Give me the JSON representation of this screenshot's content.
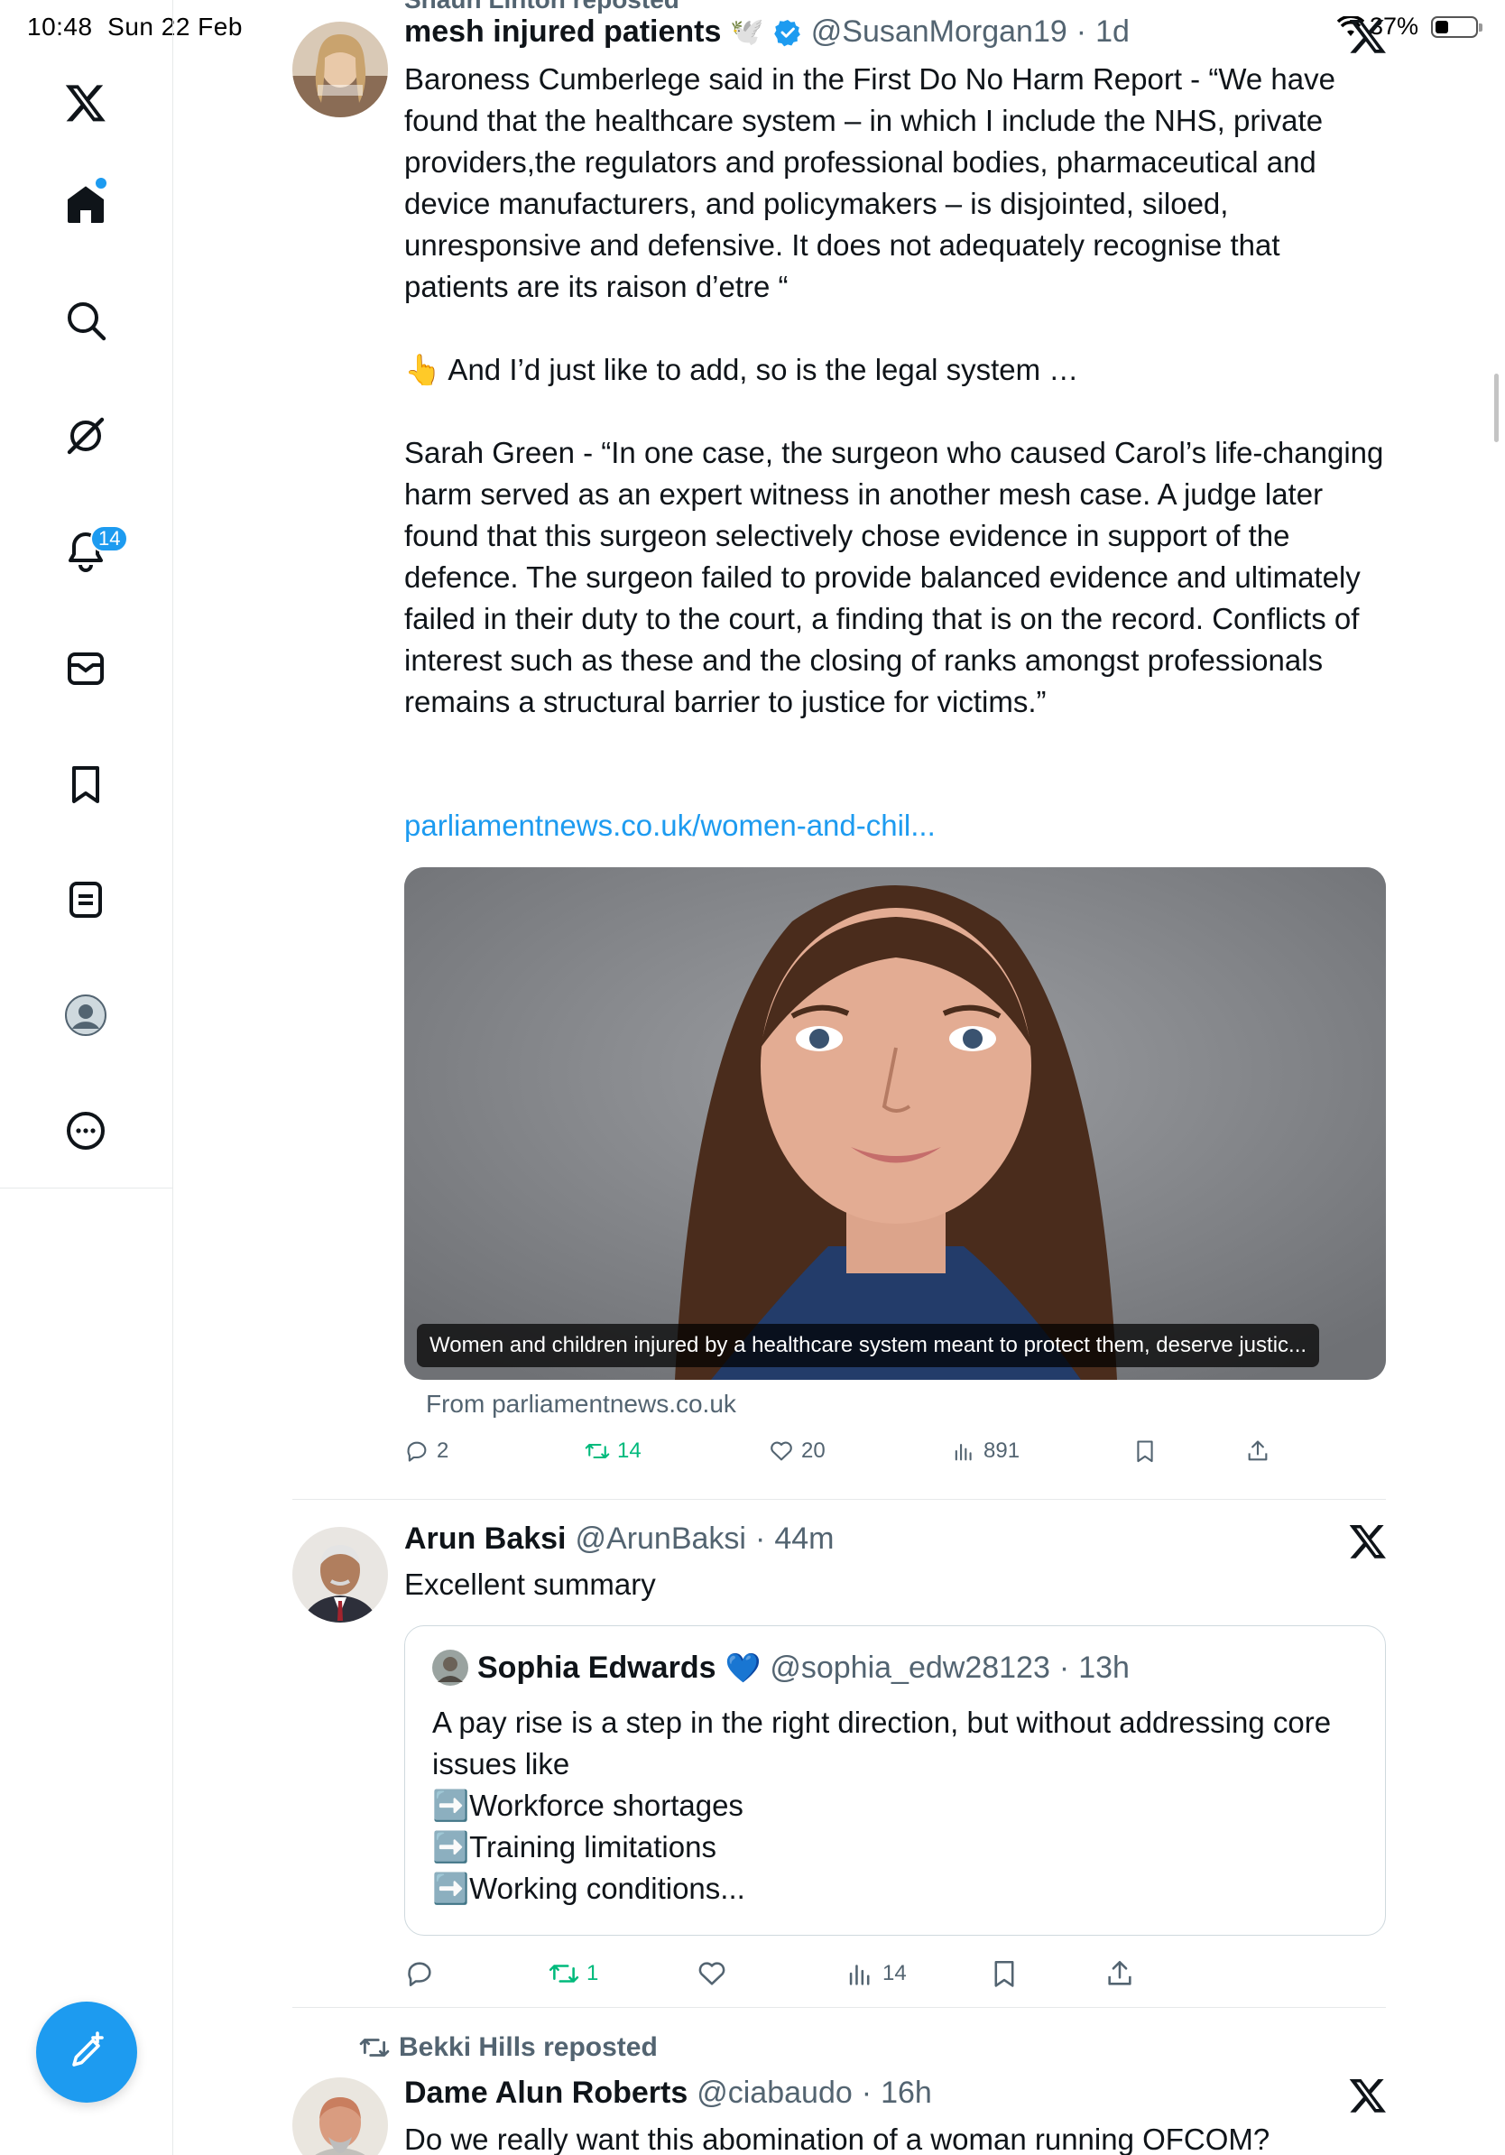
{
  "status": {
    "time": "10:48",
    "date": "Sun 22 Feb",
    "battery": "37%"
  },
  "sidebar": {
    "items": [
      {
        "icon": "x-logo-icon"
      },
      {
        "icon": "home-icon"
      },
      {
        "icon": "search-icon"
      },
      {
        "icon": "grok-icon"
      },
      {
        "icon": "notifications-icon",
        "badge": "14"
      },
      {
        "icon": "messages-icon"
      },
      {
        "icon": "bookmarks-icon"
      },
      {
        "icon": "lists-icon"
      },
      {
        "icon": "profile-icon"
      },
      {
        "icon": "more-icon"
      }
    ],
    "compose_icon": "compose-icon"
  },
  "tweet1": {
    "reposted_by": "Shaun Linton reposted",
    "name": "mesh injured patients",
    "name_emoji": "🕊️",
    "handle": "@SusanMorgan19",
    "time": "1d",
    "text": "Baroness Cumberlege said in the First Do No Harm Report - “We have found that the healthcare system – in which I include the NHS, private providers,the regulators and professional bodies, pharmaceutical and device manufacturers, and policymakers – is disjointed, siloed, unresponsive and defensive. It does not adequately recognise that patients are its raison d’etre “\n\n👆 And I’d just like to add, so is the legal system …\n\nSarah Green - “In one case, the surgeon who caused Carol’s life-changing harm served as an expert witness in another mesh case. A judge later found that this surgeon selectively chose evidence in support of the defence. The surgeon failed to provide balanced evidence and ultimately failed in their duty to the court, a finding that is on the record. Conflicts of interest such as these and the closing of ranks amongst professionals remains a structural barrier to justice for victims.”",
    "link": "parliamentnews.co.uk/women-and-chil...",
    "card_caption": "Women and children injured by a healthcare system meant to protect them, deserve justic...",
    "card_source": "From parliamentnews.co.uk",
    "replies": "2",
    "retweets": "14",
    "likes": "20",
    "views": "891"
  },
  "tweet2": {
    "name": "Arun Baksi",
    "handle": "@ArunBaksi",
    "time": "44m",
    "text": "Excellent summary",
    "quote": {
      "name": "Sophia Edwards",
      "name_emoji": "💙",
      "handle": "@sophia_edw28123",
      "time": "13h",
      "text": "A pay rise is a step in the right direction, but without addressing core issues like\n➡️Workforce shortages\n➡️Training limitations\n➡️Working conditions..."
    },
    "retweets": "1",
    "views": "14"
  },
  "tweet3": {
    "reposted_by": "Bekki Hills reposted",
    "name": "Dame Alun Roberts",
    "handle": "@ciabaudo",
    "time": "16h",
    "text": "Do we really want this abomination of a woman running OFCOM?"
  },
  "colors": {
    "accent": "#1d9bf0",
    "retweet": "#00ba7c",
    "muted": "#536471",
    "text": "#0f1419"
  }
}
